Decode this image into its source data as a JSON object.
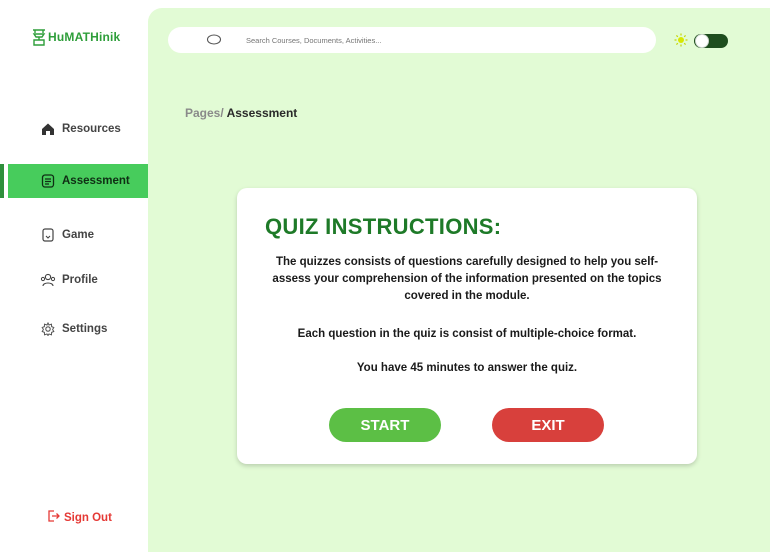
{
  "brand": {
    "name": "HuMATHinik",
    "color": "#2e9e3a",
    "icon": "logo-icon"
  },
  "sidebar": {
    "items": [
      {
        "label": "Resources",
        "icon": "home-icon",
        "active": false
      },
      {
        "label": "Assessment",
        "icon": "document-icon",
        "active": true
      },
      {
        "label": "Game",
        "icon": "bookmark-icon",
        "active": false
      },
      {
        "label": "Profile",
        "icon": "users-icon",
        "active": false
      },
      {
        "label": "Settings",
        "icon": "gear-icon",
        "active": false
      }
    ],
    "signout_label": "Sign Out",
    "active_color": "#47cc5c"
  },
  "header": {
    "search": {
      "placeholder": "Search Courses, Documents, Activities..."
    },
    "theme": {
      "icon": "sun-icon",
      "toggle_state": "on"
    }
  },
  "breadcrumb": {
    "parent": "Pages/",
    "current": "Assessment"
  },
  "quiz": {
    "title": "QUIZ INSTRUCTIONS:",
    "paragraph1": "The quizzes consists of questions carefully designed to help you self-assess your comprehension of the information presented on the topics covered in the module.",
    "paragraph2": "Each question in the quiz is consist of multiple-choice format.",
    "paragraph3": "You have 45 minutes  to answer the quiz.",
    "start_label": "START",
    "exit_label": "EXIT",
    "start_color": "#5cbf45",
    "exit_color": "#d8403c"
  },
  "colors": {
    "main_bg": "#e2fbd5",
    "title": "#1e7a28"
  }
}
